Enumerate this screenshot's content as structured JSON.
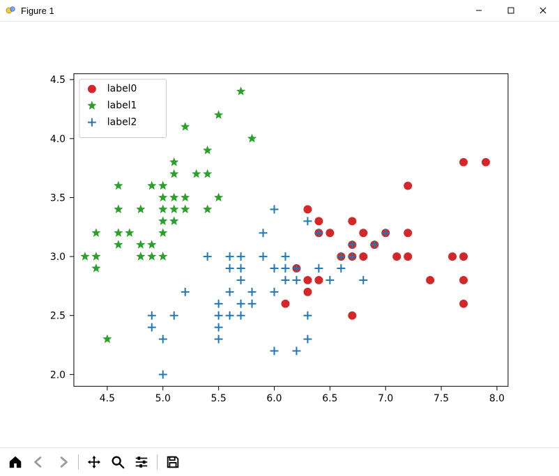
{
  "window": {
    "title": "Figure 1",
    "controls": {
      "minimize": "minimize",
      "maximize": "maximize",
      "close": "close"
    }
  },
  "toolbar": {
    "home": "Home",
    "back": "Back",
    "forward": "Forward",
    "pan": "Pan",
    "zoom": "Zoom",
    "subplots": "Configure subplots",
    "save": "Save"
  },
  "legend": {
    "items": [
      {
        "label": "label0",
        "color": "#d62728",
        "marker": "circle"
      },
      {
        "label": "label1",
        "color": "#2ca02c",
        "marker": "star"
      },
      {
        "label": "label2",
        "color": "#1f77b4",
        "marker": "plus"
      }
    ]
  },
  "axes": {
    "xticks": [
      "4.5",
      "5.0",
      "5.5",
      "6.0",
      "6.5",
      "7.0",
      "7.5",
      "8.0"
    ],
    "yticks": [
      "2.0",
      "2.5",
      "3.0",
      "3.5",
      "4.0",
      "4.5"
    ]
  },
  "colors": {
    "label0": "#d62728",
    "label1": "#2ca02c",
    "label2": "#1f77b4"
  },
  "chart_data": {
    "type": "scatter",
    "title": "",
    "xlabel": "",
    "ylabel": "",
    "xlim": [
      4.2,
      8.1
    ],
    "ylim": [
      1.9,
      4.55
    ],
    "series": [
      {
        "name": "label0",
        "color": "#d62728",
        "marker": "circle",
        "points": [
          [
            6.1,
            2.6
          ],
          [
            6.2,
            2.9
          ],
          [
            6.3,
            2.7
          ],
          [
            6.3,
            2.8
          ],
          [
            6.3,
            3.4
          ],
          [
            6.4,
            2.8
          ],
          [
            6.4,
            3.2
          ],
          [
            6.4,
            3.3
          ],
          [
            6.5,
            3.2
          ],
          [
            6.6,
            3.0
          ],
          [
            6.7,
            2.5
          ],
          [
            6.7,
            3.0
          ],
          [
            6.7,
            3.1
          ],
          [
            6.7,
            3.3
          ],
          [
            6.8,
            3.0
          ],
          [
            6.8,
            3.2
          ],
          [
            6.9,
            3.1
          ],
          [
            7.0,
            3.2
          ],
          [
            7.1,
            3.0
          ],
          [
            7.2,
            3.0
          ],
          [
            7.2,
            3.2
          ],
          [
            7.2,
            3.6
          ],
          [
            7.4,
            2.8
          ],
          [
            7.6,
            3.0
          ],
          [
            7.7,
            2.6
          ],
          [
            7.7,
            2.8
          ],
          [
            7.7,
            3.0
          ],
          [
            7.7,
            3.8
          ],
          [
            7.9,
            3.8
          ]
        ]
      },
      {
        "name": "label1",
        "color": "#2ca02c",
        "marker": "star",
        "points": [
          [
            4.3,
            3.0
          ],
          [
            4.4,
            2.9
          ],
          [
            4.4,
            3.0
          ],
          [
            4.4,
            3.2
          ],
          [
            4.5,
            2.3
          ],
          [
            4.6,
            3.1
          ],
          [
            4.6,
            3.2
          ],
          [
            4.6,
            3.4
          ],
          [
            4.6,
            3.6
          ],
          [
            4.7,
            3.2
          ],
          [
            4.8,
            3.0
          ],
          [
            4.8,
            3.1
          ],
          [
            4.8,
            3.4
          ],
          [
            4.9,
            3.0
          ],
          [
            4.9,
            3.1
          ],
          [
            4.9,
            3.6
          ],
          [
            5.0,
            3.0
          ],
          [
            5.0,
            3.2
          ],
          [
            5.0,
            3.3
          ],
          [
            5.0,
            3.4
          ],
          [
            5.0,
            3.5
          ],
          [
            5.0,
            3.6
          ],
          [
            5.1,
            3.3
          ],
          [
            5.1,
            3.4
          ],
          [
            5.1,
            3.5
          ],
          [
            5.1,
            3.7
          ],
          [
            5.1,
            3.8
          ],
          [
            5.2,
            3.4
          ],
          [
            5.2,
            3.5
          ],
          [
            5.2,
            4.1
          ],
          [
            5.3,
            3.7
          ],
          [
            5.4,
            3.4
          ],
          [
            5.4,
            3.7
          ],
          [
            5.4,
            3.9
          ],
          [
            5.5,
            3.5
          ],
          [
            5.5,
            4.2
          ],
          [
            5.7,
            4.4
          ],
          [
            5.8,
            4.0
          ]
        ]
      },
      {
        "name": "label2",
        "color": "#1f77b4",
        "marker": "plus",
        "points": [
          [
            4.9,
            2.4
          ],
          [
            4.9,
            2.5
          ],
          [
            5.0,
            2.0
          ],
          [
            5.0,
            2.3
          ],
          [
            5.1,
            2.5
          ],
          [
            5.2,
            2.7
          ],
          [
            5.4,
            3.0
          ],
          [
            5.5,
            2.3
          ],
          [
            5.5,
            2.4
          ],
          [
            5.5,
            2.5
          ],
          [
            5.5,
            2.6
          ],
          [
            5.6,
            2.5
          ],
          [
            5.6,
            2.7
          ],
          [
            5.6,
            2.9
          ],
          [
            5.6,
            3.0
          ],
          [
            5.7,
            2.5
          ],
          [
            5.7,
            2.6
          ],
          [
            5.7,
            2.8
          ],
          [
            5.7,
            2.9
          ],
          [
            5.7,
            3.0
          ],
          [
            5.8,
            2.6
          ],
          [
            5.8,
            2.7
          ],
          [
            5.9,
            3.0
          ],
          [
            5.9,
            3.2
          ],
          [
            6.0,
            2.2
          ],
          [
            6.0,
            2.7
          ],
          [
            6.0,
            2.9
          ],
          [
            6.0,
            3.4
          ],
          [
            6.1,
            2.8
          ],
          [
            6.1,
            2.9
          ],
          [
            6.1,
            3.0
          ],
          [
            6.2,
            2.2
          ],
          [
            6.2,
            2.8
          ],
          [
            6.2,
            2.9
          ],
          [
            6.3,
            2.3
          ],
          [
            6.3,
            2.5
          ],
          [
            6.3,
            3.3
          ],
          [
            6.4,
            2.9
          ],
          [
            6.4,
            3.2
          ],
          [
            6.5,
            2.8
          ],
          [
            6.6,
            2.9
          ],
          [
            6.6,
            3.0
          ],
          [
            6.7,
            3.0
          ],
          [
            6.7,
            3.1
          ],
          [
            6.8,
            2.8
          ],
          [
            6.9,
            3.1
          ],
          [
            7.0,
            3.2
          ]
        ]
      }
    ]
  }
}
